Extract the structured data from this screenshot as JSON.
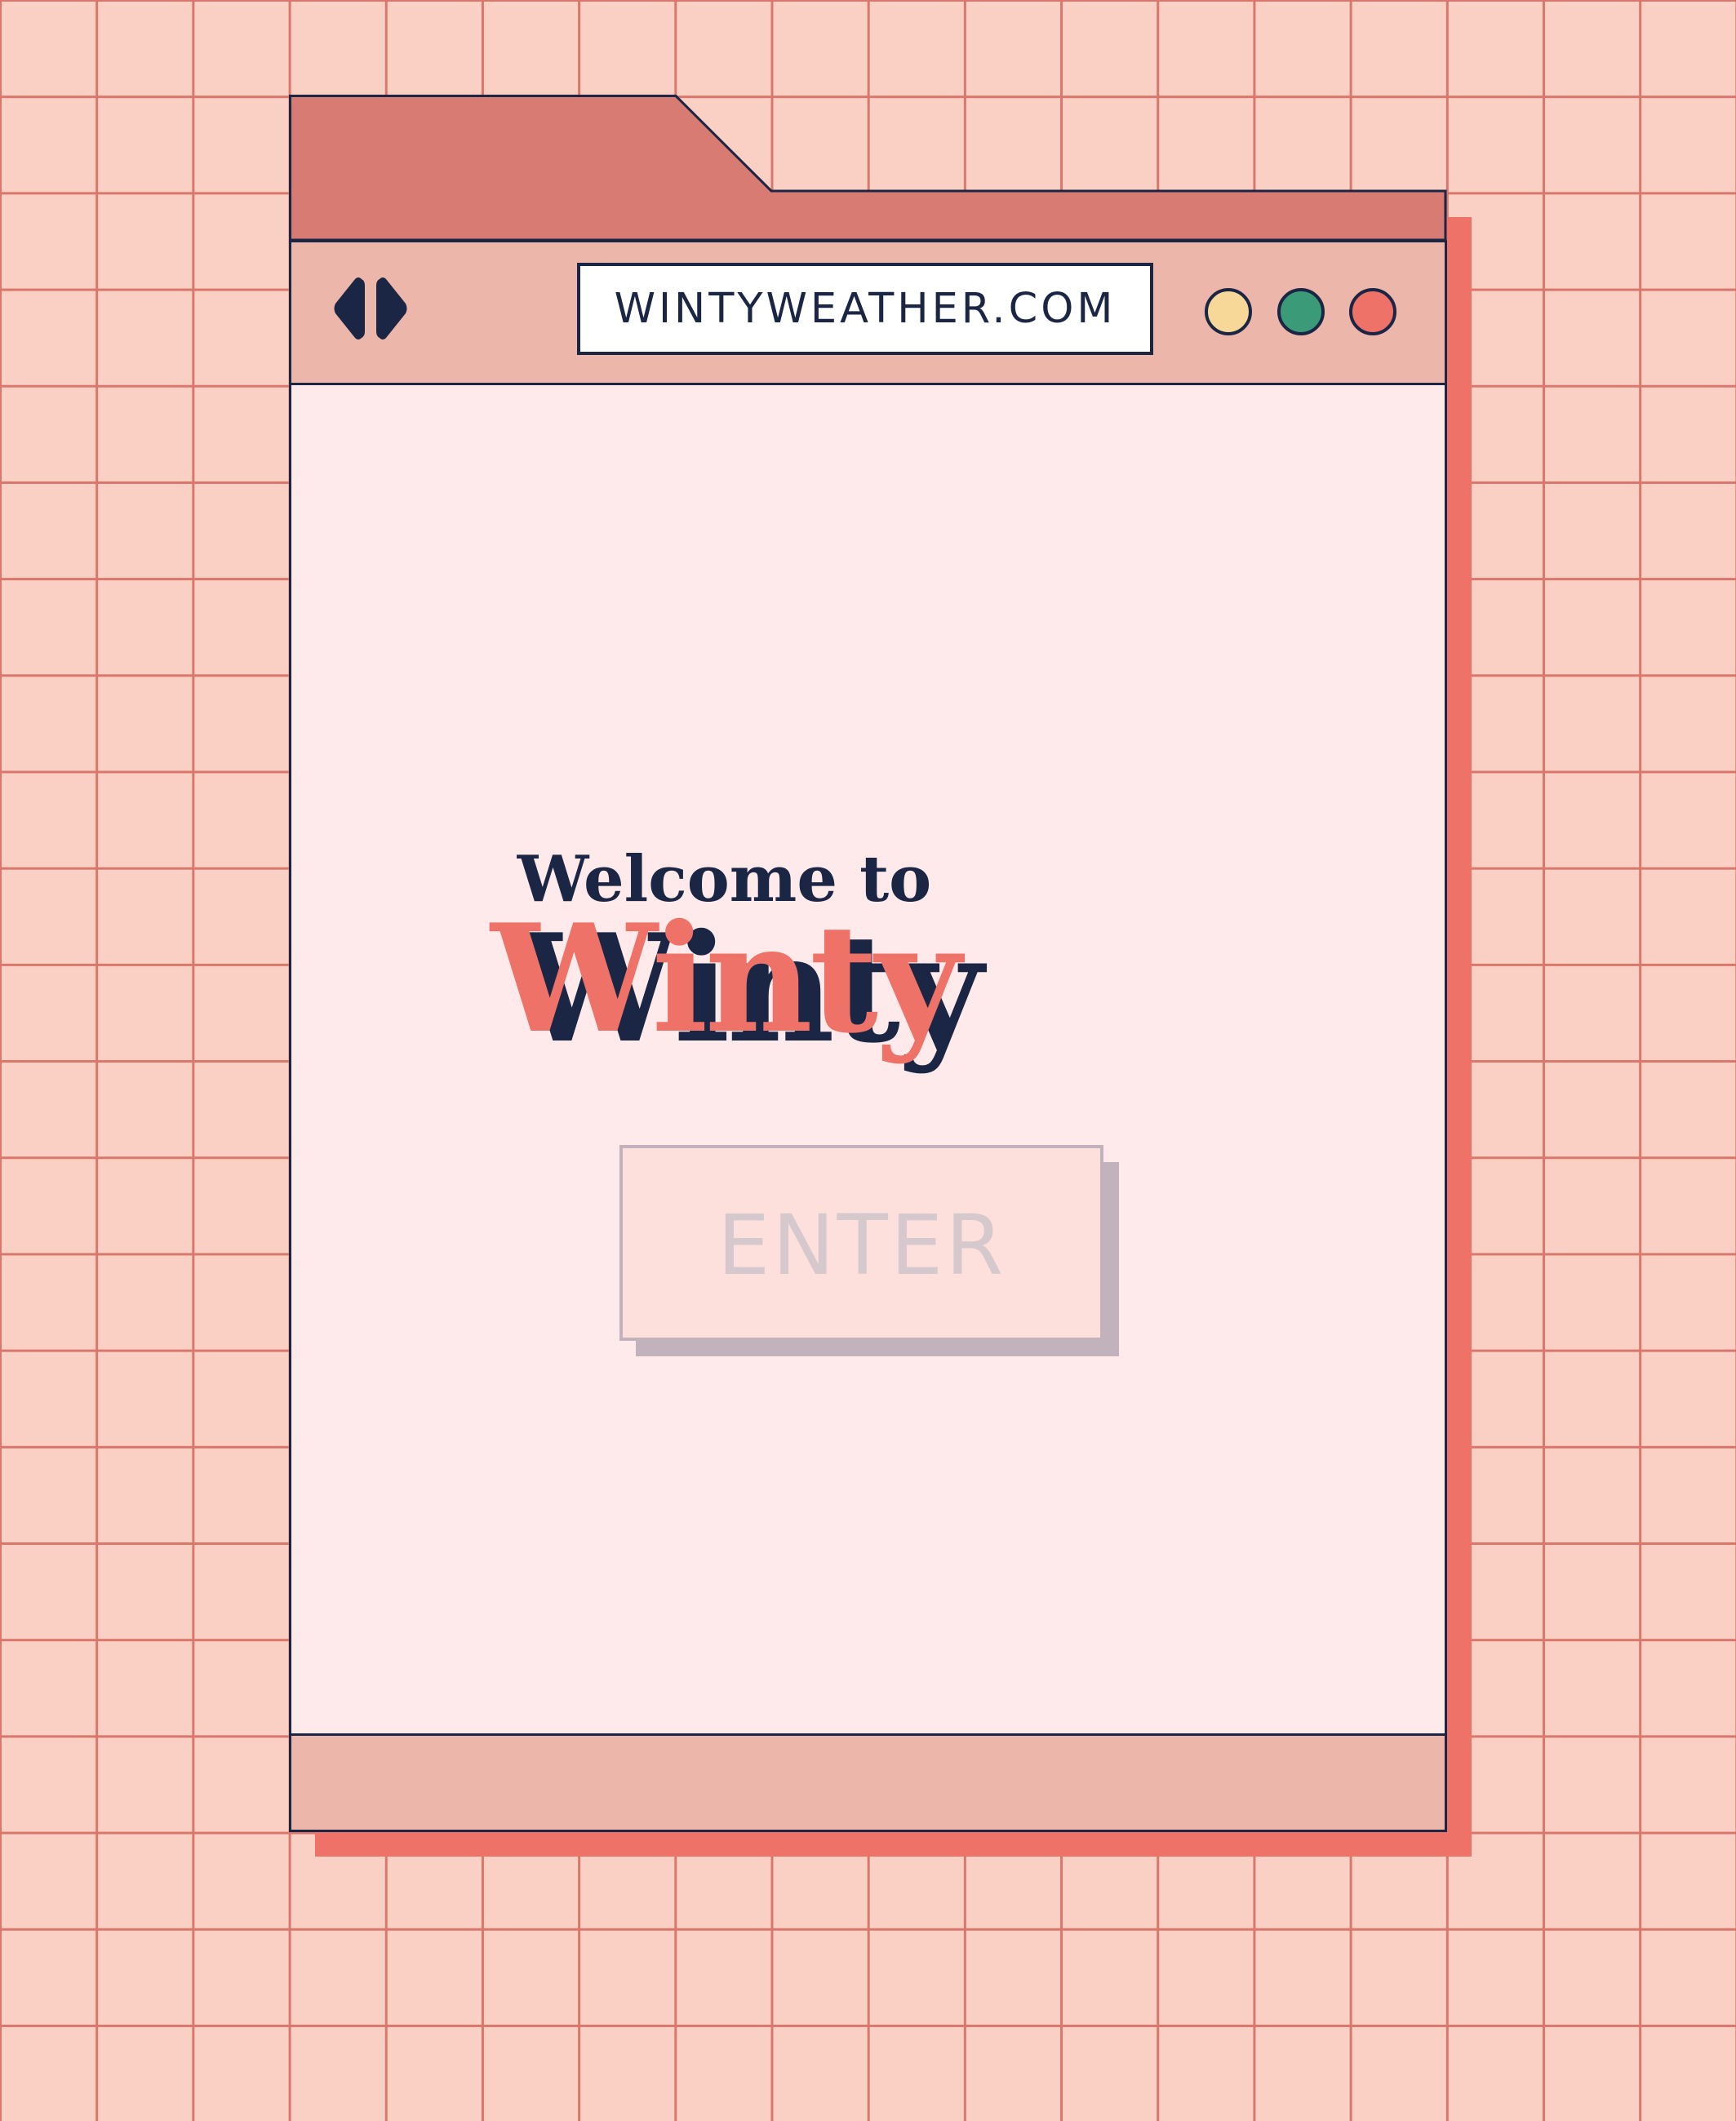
{
  "browser": {
    "url": "WINTYWEATHER.COM",
    "window_buttons": [
      {
        "name": "yellow",
        "color": "#f8d898"
      },
      {
        "name": "green",
        "color": "#3b9a78"
      },
      {
        "name": "red",
        "color": "#ee7268"
      }
    ],
    "nav_icons": [
      "back-arrow-icon",
      "forward-arrow-icon"
    ]
  },
  "page": {
    "welcome_text": "Welcome to",
    "brand_name": "Winty",
    "enter_label": "ENTER"
  },
  "colors": {
    "background": "#fbd0c4",
    "grid_line": "#d9776c",
    "tab": "#d87c73",
    "toolbar": "#edb6aa",
    "content": "#feeaea",
    "accent": "#ee7268",
    "ink": "#1b2645",
    "button_disabled_text": "#d6c9ce"
  }
}
